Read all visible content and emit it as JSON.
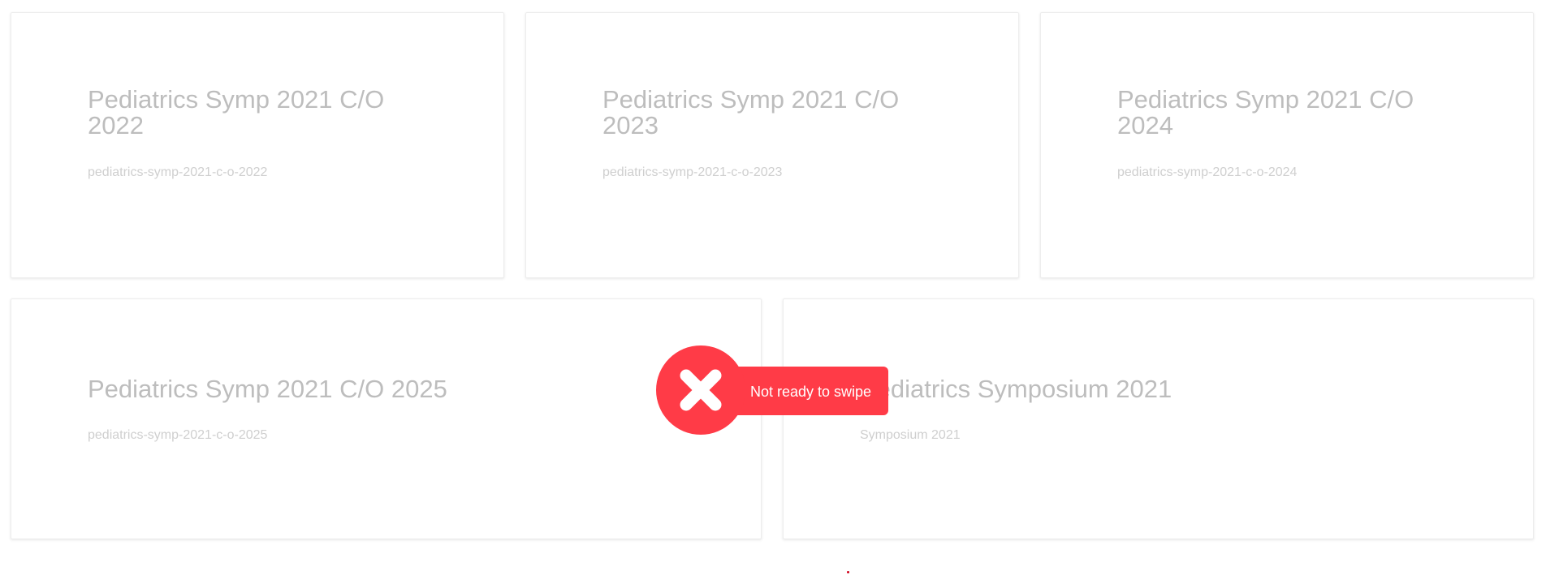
{
  "cards": [
    {
      "title": "Pediatrics Symp 2021 C/O 2022",
      "slug": "pediatrics-symp-2021-c-o-2022"
    },
    {
      "title": "Pediatrics Symp 2021 C/O 2023",
      "slug": "pediatrics-symp-2021-c-o-2023"
    },
    {
      "title": "Pediatrics Symp 2021 C/O 2024",
      "slug": "pediatrics-symp-2021-c-o-2024"
    },
    {
      "title": "Pediatrics Symp 2021 C/O 2025",
      "slug": "pediatrics-symp-2021-c-o-2025"
    },
    {
      "title": "Pediatrics Symposium 2021",
      "slug": "Symposium 2021"
    }
  ],
  "toast": {
    "label": "Not ready to swipe",
    "icon": "close-x-icon",
    "color": "#ff3b47"
  },
  "colors": {
    "card_title": "#bdbdbd",
    "card_slug": "#cfcfcf",
    "card_border": "#ededed"
  }
}
